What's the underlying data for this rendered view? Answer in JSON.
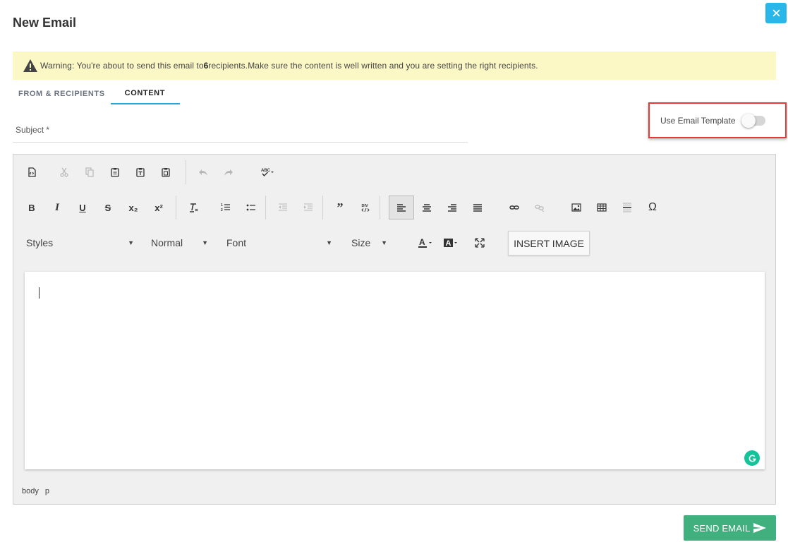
{
  "dialog": {
    "title": "New Email",
    "close_symbol": "✕"
  },
  "warning": {
    "icon": "warning-triangle-icon",
    "prefix": "Warning: You're about to send this email to ",
    "count": "6",
    "suffix": " recipients.Make sure the content is well written and you are setting the right recipients."
  },
  "tabs": [
    {
      "label": "FROM & RECIPIENTS",
      "active": false
    },
    {
      "label": "CONTENT",
      "active": true
    }
  ],
  "template_toggle": {
    "label": "Use Email Template",
    "enabled": false
  },
  "subject": {
    "label": "Subject *",
    "value": ""
  },
  "editor": {
    "toolbar": {
      "styles": "Styles",
      "format": "Normal",
      "font": "Font",
      "size": "Size",
      "insert_image": "INSERT IMAGE",
      "superscript_label": "x²",
      "subscript_label": "x₂",
      "omega": "Ω"
    },
    "content": "",
    "path": [
      "body",
      "p"
    ],
    "accent_colors": {
      "grammarly": "#15c39a"
    }
  },
  "actions": {
    "send_label": "SEND EMAIL"
  },
  "colors": {
    "primary": "#29b6e8",
    "send": "#3fb07e",
    "warning_bg": "#fcf8c6",
    "highlight": "#e53935"
  }
}
